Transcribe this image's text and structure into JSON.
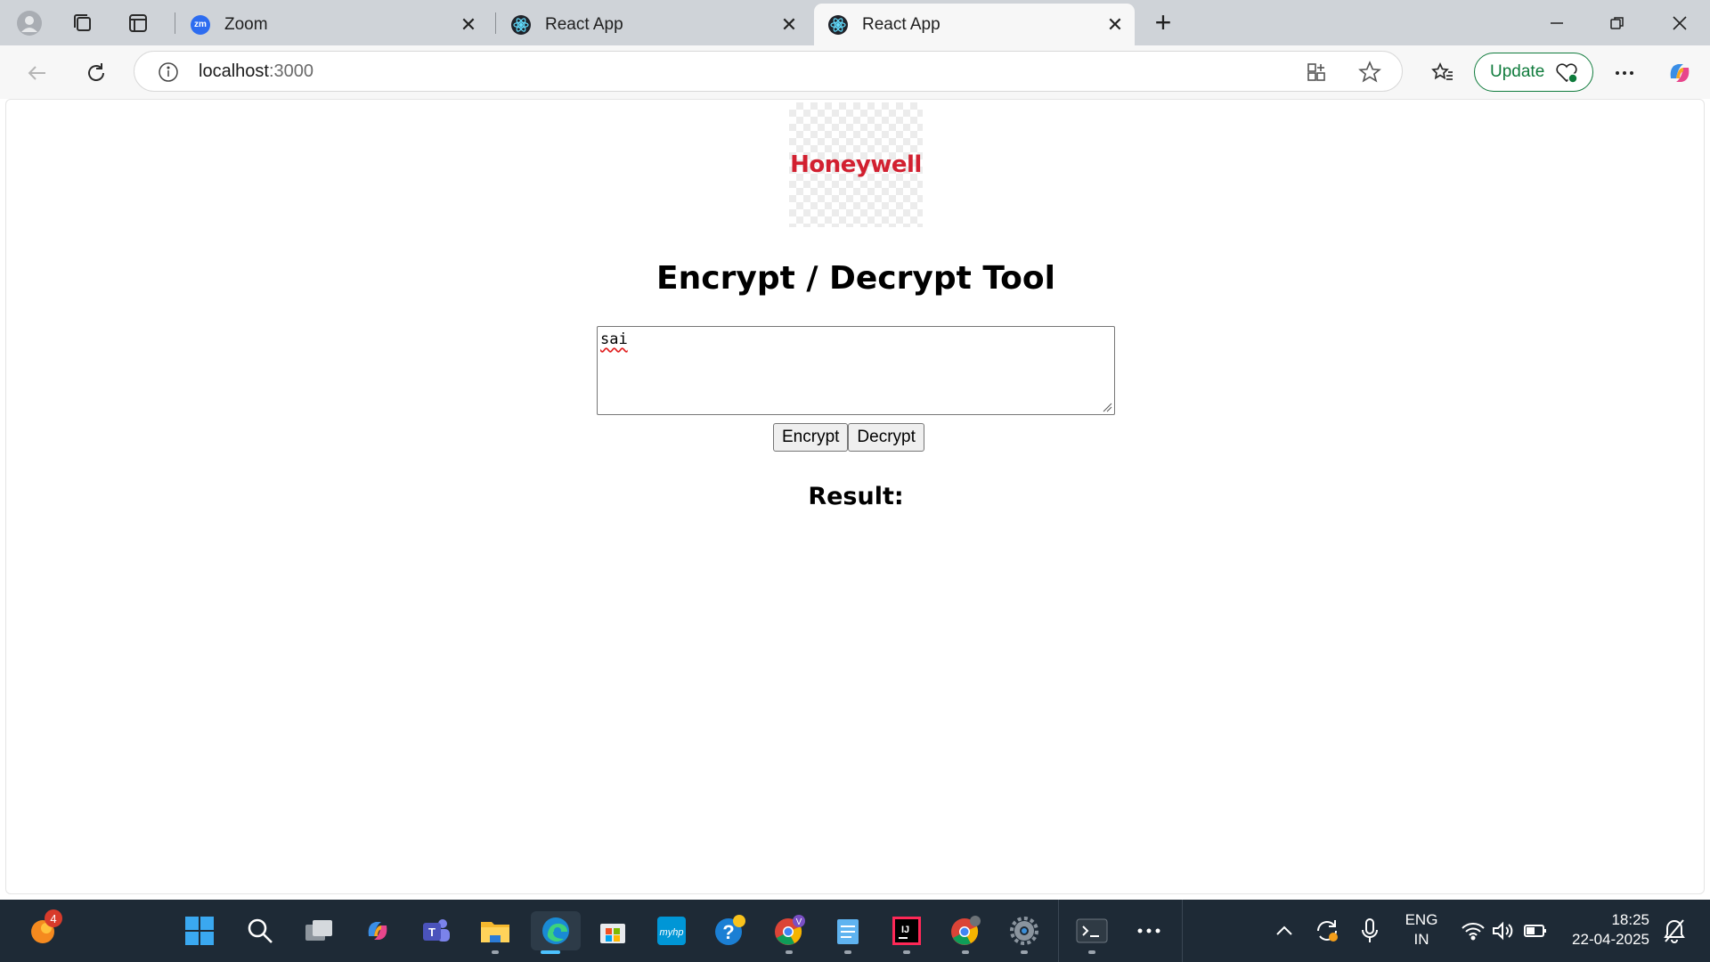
{
  "browser": {
    "tabs": [
      {
        "title": "Zoom",
        "favicon": "zoom-icon",
        "active": false
      },
      {
        "title": "React App",
        "favicon": "react-icon",
        "active": false
      },
      {
        "title": "React App",
        "favicon": "react-icon",
        "active": true
      }
    ],
    "url_host": "localhost",
    "url_port": ":3000",
    "update_label": "Update"
  },
  "page": {
    "logo_text": "Honeywell",
    "heading": "Encrypt / Decrypt Tool",
    "input_value": "sai",
    "encrypt_label": "Encrypt",
    "decrypt_label": "Decrypt",
    "result_label": "Result:"
  },
  "taskbar": {
    "notification_count": "4",
    "language_line1": "ENG",
    "language_line2": "IN",
    "time": "18:25",
    "date": "22-04-2025"
  },
  "colors": {
    "brand_red": "#d22030",
    "update_green": "#0f7b3c",
    "taskbar_bg": "#1e2a36"
  }
}
